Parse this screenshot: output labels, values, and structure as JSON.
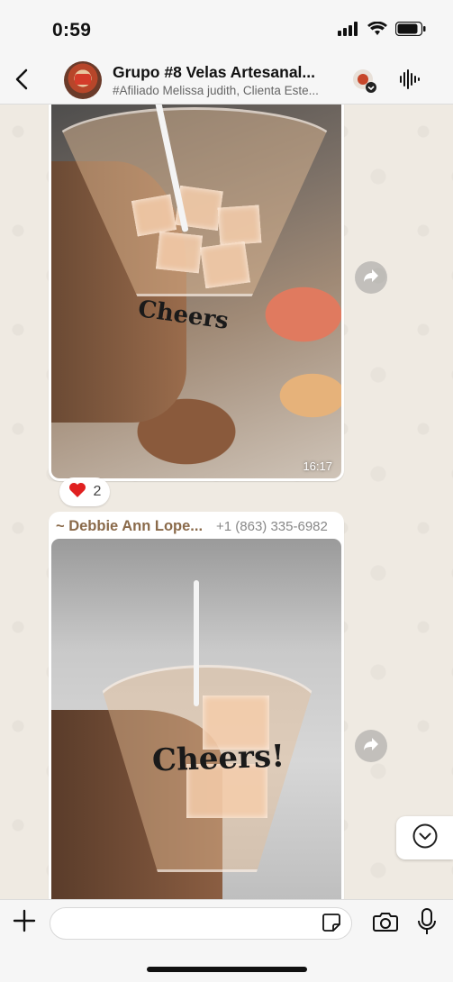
{
  "status_bar": {
    "time": "0:59",
    "icons": [
      "signal-icon",
      "wifi-icon",
      "battery-icon"
    ]
  },
  "header": {
    "title": "Grupo #8 Velas Artesanal...",
    "subtitle": "#Afiliado Melissa judith, Clienta Este...",
    "icons": [
      "back-icon",
      "group-avatar",
      "voice-wave-icon"
    ]
  },
  "messages": [
    {
      "type": "image",
      "time": "16:17",
      "image_text": "Cheers",
      "reaction": {
        "emoji": "❤️",
        "count": "2"
      }
    },
    {
      "type": "image",
      "sender": "~ Debbie Ann Lope...",
      "sender_phone": "+1 (863) 335-6982",
      "image_text": "Cheers!"
    }
  ],
  "input_bar": {
    "placeholder": "",
    "icons": [
      "plus-icon",
      "sticker-icon",
      "camera-icon",
      "mic-icon"
    ]
  },
  "colors": {
    "chat_bg": "#efeae2",
    "sender_name": "#8a6a4a",
    "bubble": "#ffffff"
  }
}
